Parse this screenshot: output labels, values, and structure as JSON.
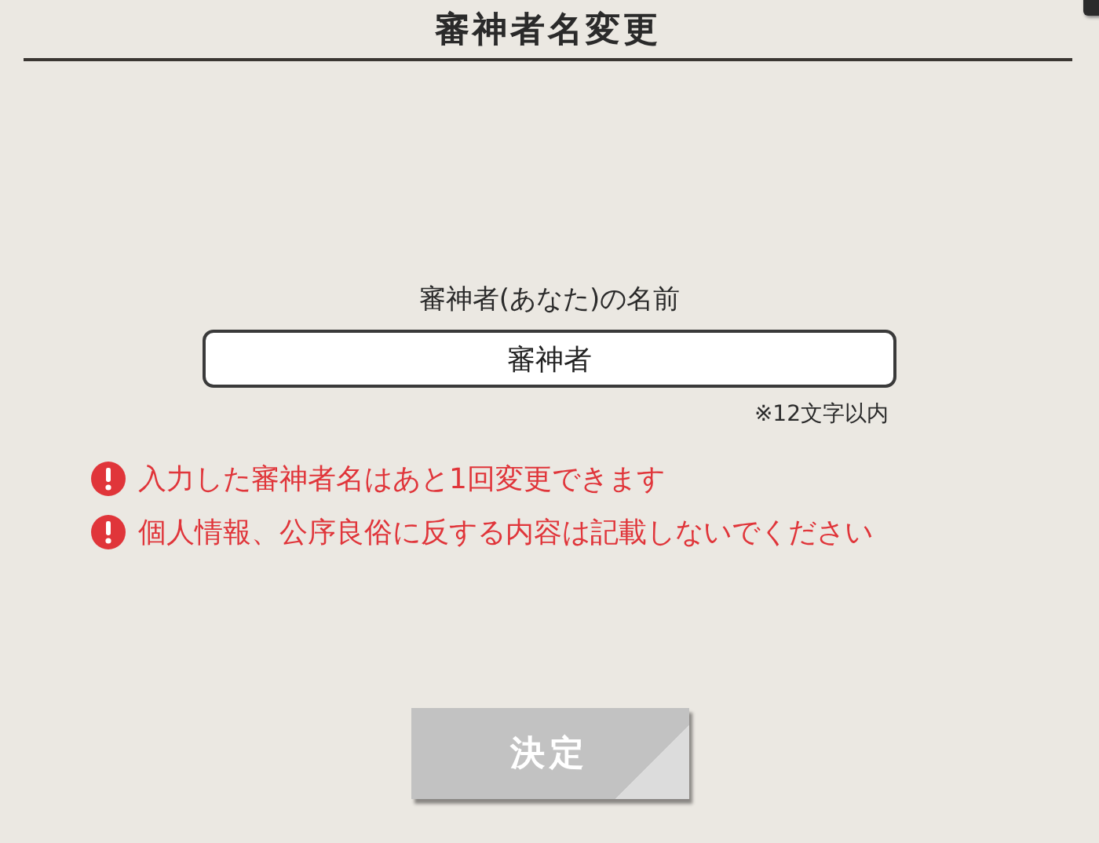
{
  "dialog": {
    "title": "審神者名変更"
  },
  "name_field": {
    "label": "審神者(あなた)の名前",
    "value": "審神者",
    "note": "※12文字以内"
  },
  "warnings": [
    "入力した審神者名はあと1回変更できます",
    "個人情報、公序良俗に反する内容は記載しないでください"
  ],
  "confirm_button": {
    "label": "決定",
    "disabled": true
  }
}
